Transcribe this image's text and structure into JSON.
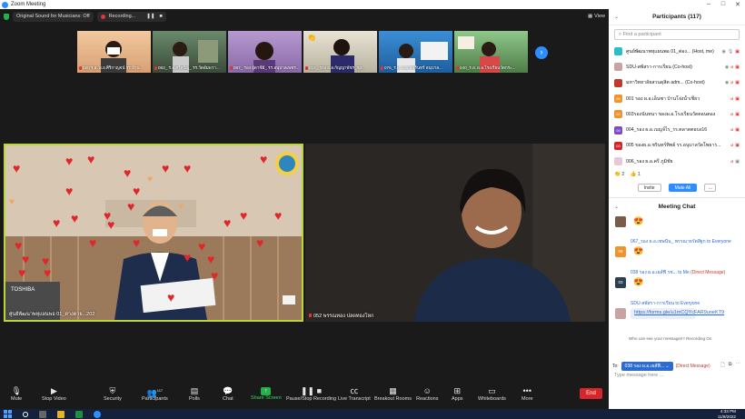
{
  "window": {
    "title": "Zoom Meeting",
    "controls": [
      "–",
      "□",
      "✕"
    ]
  },
  "topbar": {
    "sound_label": "Original Sound for Musicians: Off",
    "recording_label": "Recording...",
    "view_label": "View"
  },
  "gallery": [
    {
      "name": "020 ร.อ. ผ.อ.ศิริกาญจน์ รร.บ้าน..."
    },
    {
      "name": "083_ ร.อ.ศรีสุปัญ_ รร.วัดอัมพวา..."
    },
    {
      "name": "087_ รอง ผู้ตาซีย์_ รร.อนุบาลเพชร..."
    },
    {
      "name": "015_ รอง ผ.อ.กัญญาพัชร_ซุง..."
    },
    {
      "name": "076_ร.อ. ผ.อ.พัชรินทร์ อนุบาล..."
    },
    {
      "name": "040_ร.อ. ผ.อ.โรงเรียนวัดกระ..."
    }
  ],
  "main_tiles": {
    "left_name": "ศูนย์พัฒนาพหุแผนพอ 01_ต่างตาย...202",
    "right_name": "052 พรรณทอง ปลดทองโหก"
  },
  "toolbar": {
    "mute": "Mute",
    "stop_video": "Stop Video",
    "security": "Security",
    "participants": "Participants",
    "participants_count": "117",
    "polls": "Polls",
    "chat": "Chat",
    "share_screen": "Share Screen",
    "pause_recording": "Pause/Stop Recording",
    "live_transcript": "Live Transcript",
    "breakout_rooms": "Breakout Rooms",
    "reactions": "Reactions",
    "apps": "Apps",
    "whiteboards": "Whiteboards",
    "more": "More",
    "end": "End"
  },
  "participants_panel": {
    "title": "Participants (117)",
    "search_placeholder": "Find a participant",
    "rows": [
      {
        "name": "ศูนย์พัฒนาพหุแผนพอ 01_ต่อง... (Host, me)",
        "color": "#28c0c8",
        "initials": ""
      },
      {
        "name": "SDU-สพัสรา-การเรียน (Co-host)",
        "color": "#ffffff",
        "initials": ""
      },
      {
        "name": "มหาวิทยาลัยสวนดุสิต adm... (Co-host)",
        "color": "#c0392b",
        "initials": ""
      },
      {
        "name": "001 รอง ผ.อ.เอ็นซา บ้านโจ่งน้ำเชียว",
        "color": "#f0932b",
        "initials": "00"
      },
      {
        "name": "003รองนันทนา ของผ.อ.โรงเรียนวัดตอนตอง",
        "color": "#f0932b",
        "initials": "00"
      },
      {
        "name": "004_รอง ผ.อ.เบญจ์ไร_รร.ตลาดตอบง16",
        "color": "#7d4cc8",
        "initials": "00"
      },
      {
        "name": "005 ของผ.อ.ชรินทร์ทิพย์ รร.อนุบาลวัดโพธาร...",
        "color": "#d6262b",
        "initials": "00"
      },
      {
        "name": "006_รอง ผ.อ.ครี ภูมิชัย",
        "color": "#e8e8e8",
        "initials": ""
      }
    ],
    "reactions": [
      "👏 2",
      "👍 1"
    ],
    "invite_label": "Invite",
    "mute_all_label": "Mute All",
    "more_label": "…"
  },
  "chat_panel": {
    "title": "Meeting Chat",
    "messages": [
      {
        "from": "",
        "content": "😍"
      },
      {
        "from": "067_รอง ผ.อ.เชษนีน_ พรรณาธรัตสีฐก to Everyone",
        "content": "😍"
      },
      {
        "from": "038 รอง ผ.อ.เยส์ฟี  รช... to Me ",
        "dm": "(Direct Message)",
        "content": "😍"
      },
      {
        "from": "SDU-สพัสรา-การเรียน to Everyone",
        "content": "https://forms.gle/u1mCQYcFAR9uneKT9"
      }
    ],
    "who_can_see": "Who can see your messages? Recording On",
    "to_label": "To:",
    "to_target": "038 รอง ผ.อ.เยส์ฟี...",
    "to_dm": "(Direct Message)",
    "input_placeholder": "Type message here ..."
  },
  "taskbar": {
    "time": "4:33 PM",
    "date": "11/9/2022"
  }
}
